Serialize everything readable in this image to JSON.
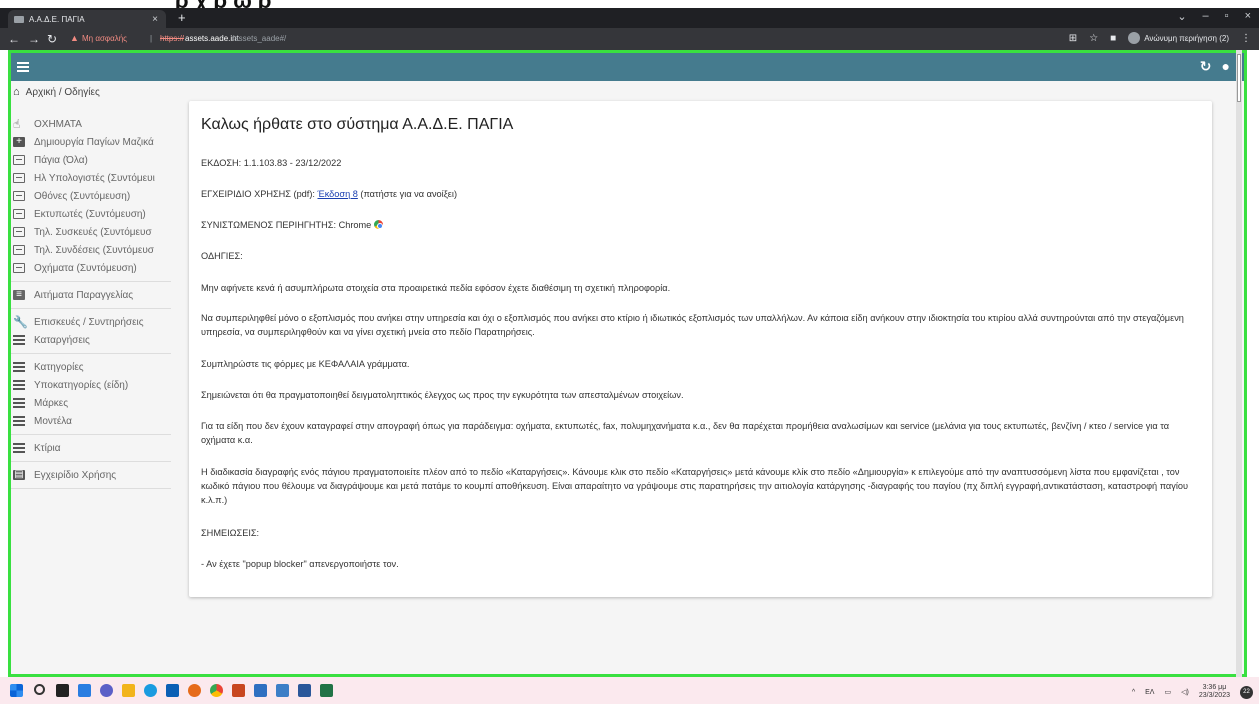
{
  "browser": {
    "tab_title": "Α.Α.Δ.Ε. ΠΑΓΙΑ",
    "tab_close": "×",
    "new_tab": "+",
    "window_controls": [
      "⌄",
      "–",
      "▫",
      "×"
    ],
    "insecure_label": "Μη ασφαλής",
    "url_scheme": "https://",
    "url_host": "assets.aade.int",
    "url_path": "/assets_aade#/",
    "profile_label": "Ανώνυμη περιήγηση (2)"
  },
  "app": {
    "refresh_icon": "↻",
    "account_icon": "●"
  },
  "breadcrumb": {
    "text": "Αρχική / Οδηγίες"
  },
  "sidebar": {
    "items": [
      {
        "label": "ΟΧΗΜΑΤΑ",
        "icon": "pointer-icon"
      },
      {
        "label": "Δημιουργία Παγίων Μαζικά",
        "icon": "add-box-icon"
      },
      {
        "label": "Πάγια (Όλα)",
        "icon": "list-icon"
      },
      {
        "label": "Ηλ Υπολογιστές (Συντόμευι",
        "icon": "list-icon"
      },
      {
        "label": "Οθόνες (Συντόμευση)",
        "icon": "list-icon"
      },
      {
        "label": "Εκτυπωτές (Συντόμευση)",
        "icon": "list-icon"
      },
      {
        "label": "Τηλ. Συσκευές (Συντόμευσ",
        "icon": "list-icon"
      },
      {
        "label": "Τηλ. Συνδέσεις (Συντόμευσ",
        "icon": "list-icon"
      },
      {
        "label": "Οχήματα (Συντόμευση)",
        "icon": "list-icon"
      },
      {
        "label": "Αιτήματα Παραγγελίας",
        "icon": "request-icon"
      },
      {
        "label": "Επισκευές / Συντηρήσεις",
        "icon": "wrench-icon"
      },
      {
        "label": "Καταργήσεις",
        "icon": "delete-list-icon"
      },
      {
        "label": "Κατηγορίες",
        "icon": "lines-icon"
      },
      {
        "label": "Υποκατηγορίες (είδη)",
        "icon": "lines-icon"
      },
      {
        "label": "Μάρκες",
        "icon": "lines-icon"
      },
      {
        "label": "Μοντέλα",
        "icon": "lines-icon"
      },
      {
        "label": "Κτίρια",
        "icon": "lines-icon"
      },
      {
        "label": "Εγχειρίδιο Χρήσης",
        "icon": "manual-icon"
      }
    ]
  },
  "content": {
    "title": "Καλως ήρθατε στο σύστημα Α.Α.Δ.Ε. ΠΑΓΙΑ",
    "version": "ΕΚΔΟΣΗ: 1.1.103.83 - 23/12/2022",
    "manual_prefix": "ΕΓΧΕΙΡΙΔΙΟ ΧΡΗΣΗΣ (pdf): ",
    "manual_link": "Έκδοση 8",
    "manual_suffix": " (πατήστε για να ανοίξει)",
    "browser_note": "ΣΥΝΙΣΤΩΜΕΝΟΣ ΠΕΡΙΗΓΗΤΗΣ: Chrome",
    "instructions_heading": "ΟΔΗΓΙΕΣ:",
    "p1": "Μην αφήνετε κενά ή ασυμπλήρωτα στοιχεία στα προαιρετικά πεδία εφόσον έχετε διαθέσιμη τη σχετική πληροφορία.",
    "p2": "Να συμπεριληφθεί μόνο ο εξοπλισμός που ανήκει στην υπηρεσία και όχι ο εξοπλισμός που ανήκει στο κτίριο ή ιδιωτικός εξοπλισμός των υπαλλήλων. Αν κάποια είδη ανήκουν στην ιδιοκτησία του κτιρίου αλλά συντηρούνται από την στεγαζόμενη υπηρεσία, να συμπεριληφθούν και να γίνει σχετική μνεία στο πεδίο Παρατηρήσεις.",
    "p3": "Συμπληρώστε τις φόρμες με ΚΕΦΑΛΑΙΑ γράμματα.",
    "p4": "Σημειώνεται ότι θα πραγματοποιηθεί δειγματοληπτικός έλεγχος ως προς την εγκυρότητα των απεσταλμένων στοιχείων.",
    "p5": "Για τα είδη που δεν έχουν καταγραφεί στην απογραφή όπως για παράδειγμα: οχήματα, εκτυπωτές, fax, πολυμηχανήματα κ.α., δεν θα παρέχεται προμήθεια αναλωσίμων και service (μελάνια για τους εκτυπωτές, βενζίνη / κτεο / service για τα οχήματα κ.α.",
    "p6": "Η διαδικασία διαγραφής ενός πάγιου πραγματοποιείτε πλέον από το πεδίο «Καταργήσεις». Κάνουμε κλικ στο πεδίο «Καταργήσεις» μετά κάνουμε κλίκ στο πεδίο «Δημιουργία» κ επιλεγούμε από την αναπτυσσόμενη λίστα που εμφανίζεται , τον κωδικό πάγιου που θέλουμε να διαγράψουμε και μετά πατάμε το κουμπί αποθήκευση. Είναι απαραίτητο να γράψουμε στις παρατηρήσεις την αιτιολογία κατάργησης -διαγραφής του παγίου (πχ διπλή εγγραφή,αντικατάσταση, καταστροφή παγίου κ.λ.π.)",
    "notes_heading": "ΣΗΜΕΙΩΣΕΙΣ:",
    "note1": "- Αν έχετε \"popup blocker\" απενεργοποιήστε τον."
  },
  "taskbar": {
    "lang": "ΕΛ",
    "time": "3:36 μμ",
    "date": "23/3/2023",
    "notifications": "22"
  }
}
